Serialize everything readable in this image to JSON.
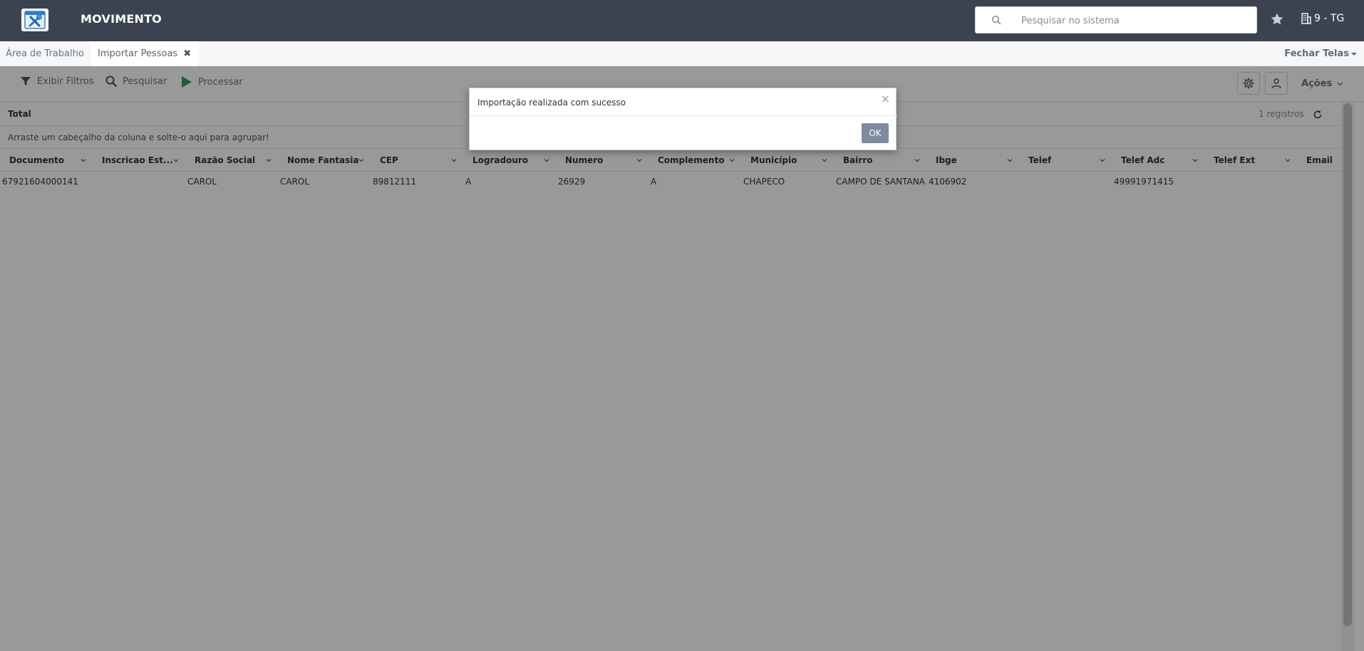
{
  "header": {
    "app_title": "MOVIMENTO",
    "search_placeholder": "Pesquisar no sistema",
    "company": "9 - TG"
  },
  "tabs": [
    {
      "label": "Área de Trabalho"
    },
    {
      "label": "Importar Pessoas",
      "active": true
    }
  ],
  "close_all_label": "Fechar Telas",
  "toolbar": {
    "filters_label": "Exibir Filtros",
    "search_label": "Pesquisar",
    "process_label": "Processar",
    "actions_label": "Ações"
  },
  "grid": {
    "summary_label": "Total",
    "count_label": "1 registros",
    "group_hint": "Arraste um cabeçalho da coluna e solte-o aqui para agrupar!",
    "columns": [
      "Documento",
      "Inscricao Est...",
      "Razão Social",
      "Nome Fantasia",
      "CEP",
      "Logradouro",
      "Numero",
      "Complemento",
      "Município",
      "Bairro",
      "Ibge",
      "Telef",
      "Telef Adc",
      "Telef Ext",
      "Email"
    ],
    "rows": [
      [
        "67921604000141",
        "",
        "CAROL",
        "CAROL",
        "89812111",
        "A",
        "26929",
        "A",
        "CHAPECO",
        "CAMPO DE SANTANA",
        "4106902",
        "",
        "49991971415",
        "",
        ""
      ]
    ]
  },
  "dialog": {
    "message": "Importação realizada com sucesso",
    "close_glyph": "×",
    "ok_label": "OK"
  },
  "colors": {
    "topbar": "#3c4350",
    "ok_button": "#7e8ba0",
    "process_icon": "#2e9e5b"
  }
}
